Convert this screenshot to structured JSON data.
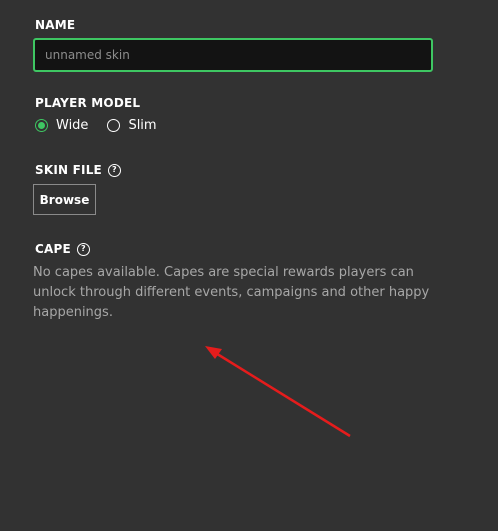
{
  "name": {
    "label": "NAME",
    "placeholder": "unnamed skin"
  },
  "player_model": {
    "label": "PLAYER MODEL",
    "options": [
      {
        "label": "Wide",
        "selected": true
      },
      {
        "label": "Slim",
        "selected": false
      }
    ]
  },
  "skin_file": {
    "label": "SKIN FILE",
    "help_glyph": "?",
    "browse_label": "Browse"
  },
  "cape": {
    "label": "CAPE",
    "help_glyph": "?",
    "description": "No capes available. Capes are special rewards players can unlock through different events, campaigns and other happy happenings."
  },
  "colors": {
    "background": "#323232",
    "accent": "#3ec662",
    "annotation_arrow": "#e51c1c"
  }
}
